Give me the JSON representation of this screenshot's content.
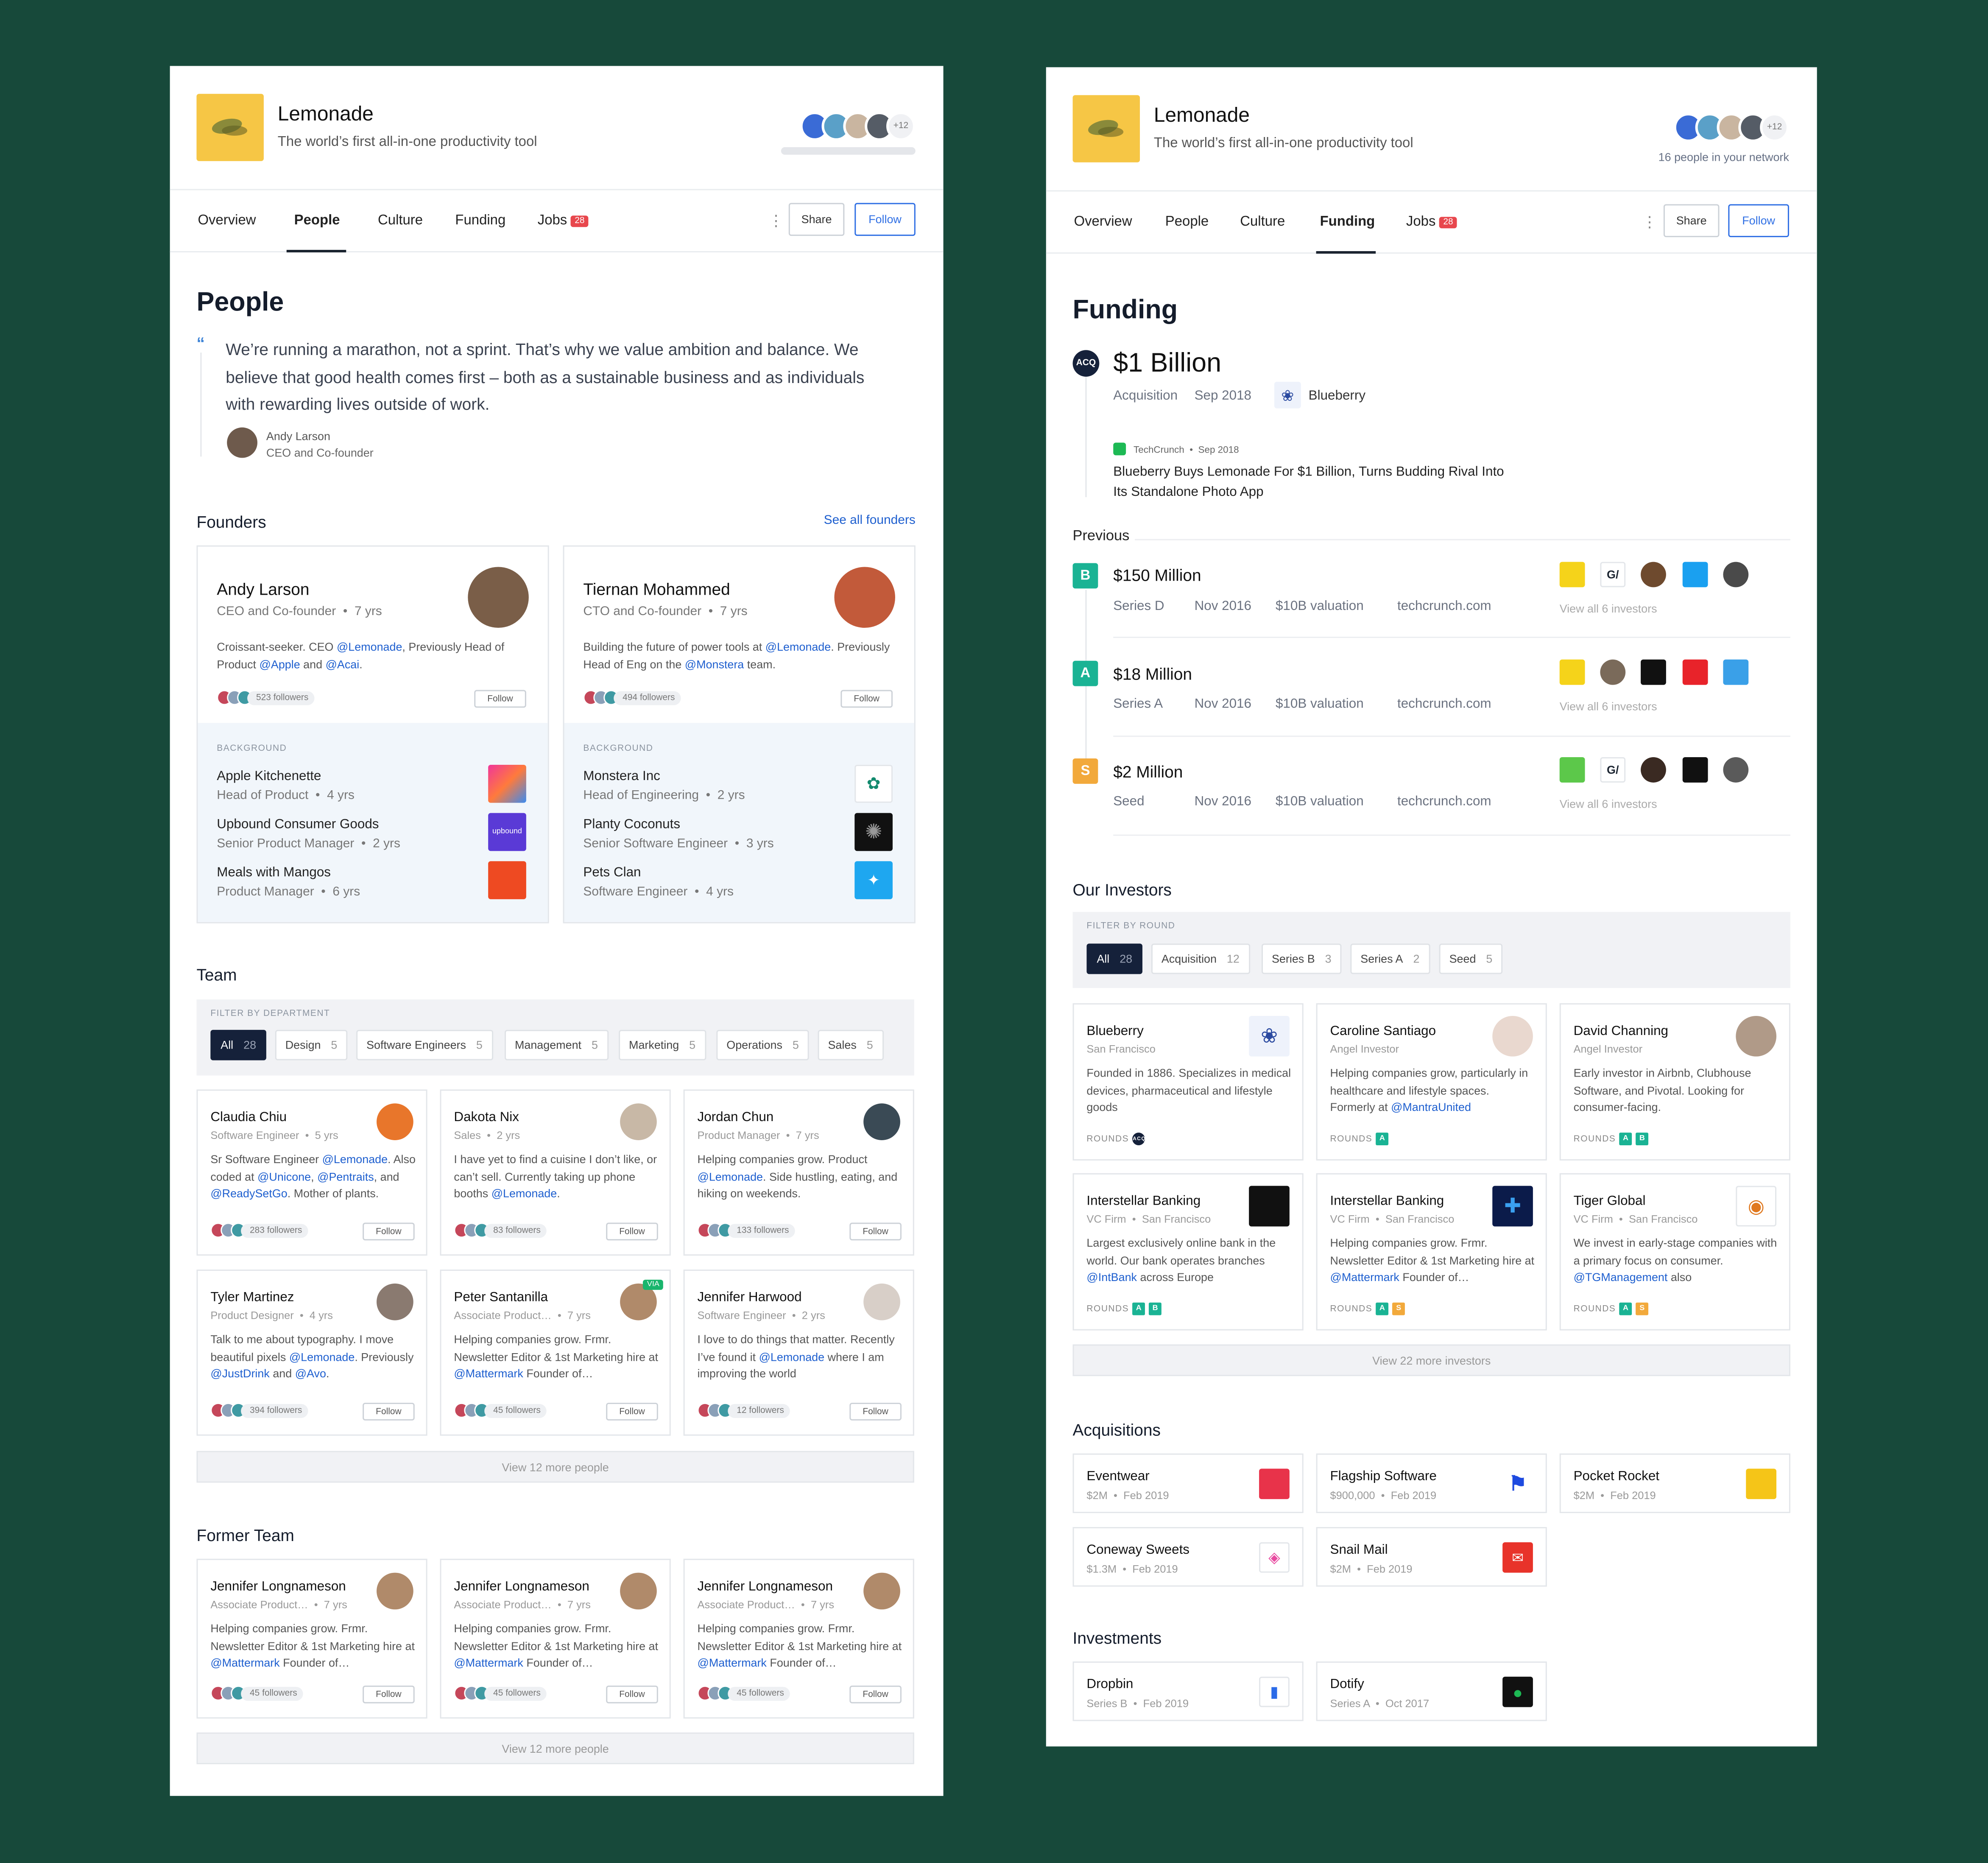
{
  "company": {
    "name": "Lemonade",
    "tagline": "The world’s first all-in-one productivity tool",
    "avatars_more": "+12",
    "network_note": "16 people in your network"
  },
  "nav": {
    "tabs": [
      "Overview",
      "People",
      "Culture",
      "Funding",
      "Jobs"
    ],
    "jobs_count": "28",
    "share": "Share",
    "follow": "Follow",
    "kebab": "⋮"
  },
  "people": {
    "title": "People",
    "quote_mark": "“",
    "quote": "We’re running a marathon, not a sprint. That’s why we value ambition and balance. We believe that good health comes first – both as a sustainable business and as individuals with rewarding lives outside of work.",
    "quote_author": "Andy Larson",
    "quote_role": "CEO and Co-founder",
    "founders_title": "Founders",
    "see_all": "See all founders",
    "founders": [
      {
        "name": "Andy Larson",
        "role": "CEO and Co-founder",
        "years": "7 yrs",
        "desc": [
          "Croissant-seeker. CEO ",
          "@Lemonade",
          ", Previously Head of Product ",
          "@Apple",
          " and ",
          "@Acai",
          "."
        ],
        "followers": "523 followers",
        "follow": "Follow",
        "background_label": "BACKGROUND",
        "background": [
          {
            "company": "Apple Kitchenette",
            "role": "Head of Product",
            "years": "4 yrs",
            "color": "#e84a8a"
          },
          {
            "company": "Upbound Consumer Goods",
            "role": "Senior Product Manager",
            "years": "2 yrs",
            "color": "#5a3ad6",
            "logo_text": "upbound"
          },
          {
            "company": "Meals with Mangos",
            "role": "Product Manager",
            "years": "6 yrs",
            "color": "#ee4a22"
          }
        ]
      },
      {
        "name": "Tiernan Mohammed",
        "role": "CTO and Co-founder",
        "years": "7 yrs",
        "desc": [
          "Building the future of power tools at ",
          "@Lemonade",
          ". Previously Head of Eng on the ",
          "@Monstera",
          " team."
        ],
        "followers": "494 followers",
        "follow": "Follow",
        "background_label": "BACKGROUND",
        "background": [
          {
            "company": "Monstera Inc",
            "role": "Head of Engineering",
            "years": "2 yrs",
            "color": "#ffffff"
          },
          {
            "company": "Planty Coconuts",
            "role": "Senior Software Engineer",
            "years": "3 yrs",
            "color": "#111111"
          },
          {
            "company": "Pets Clan",
            "role": "Software Engineer",
            "years": "4 yrs",
            "color": "#1ea7f0"
          }
        ]
      }
    ],
    "team_title": "Team",
    "filter_label": "FILTER BY DEPARTMENT",
    "filters": [
      {
        "label": "All",
        "count": "28"
      },
      {
        "label": "Design",
        "count": "5"
      },
      {
        "label": "Software Engineers",
        "count": "5"
      },
      {
        "label": "Management",
        "count": "5"
      },
      {
        "label": "Marketing",
        "count": "5"
      },
      {
        "label": "Operations",
        "count": "5"
      },
      {
        "label": "Sales",
        "count": "5"
      }
    ],
    "team": [
      {
        "name": "Claudia Chiu",
        "role": "Software Engineer",
        "years": "5 yrs",
        "desc": [
          "Sr Software Engineer ",
          "@Lemonade",
          ". Also coded at ",
          "@Unicone",
          ", ",
          "@Pentraits",
          ", and ",
          "@ReadySetGo",
          ". Mother of plants."
        ],
        "followers": "283 followers",
        "follow": "Follow",
        "avatar": "#e8762b"
      },
      {
        "name": "Dakota Nix",
        "role": "Sales",
        "years": "2 yrs",
        "desc": [
          "I have yet to find a cuisine I don’t like, or can’t sell. Currently taking up phone booths ",
          "@Lemonade",
          "."
        ],
        "followers": "83 followers",
        "follow": "Follow",
        "avatar": "#c8b8a6"
      },
      {
        "name": "Jordan Chun",
        "role": "Product Manager",
        "years": "7 yrs",
        "desc": [
          "Helping companies grow. Product ",
          "@Lemonade",
          ". Side hustling, eating, and hiking on weekends."
        ],
        "followers": "133 followers",
        "follow": "Follow",
        "avatar": "#3a4a55"
      },
      {
        "name": "Tyler Martinez",
        "role": "Product Designer",
        "years": "4 yrs",
        "desc": [
          "Talk to me about typography. I move beautiful pixels ",
          "@Lemonade",
          ". Previously ",
          "@JustDrink",
          " and ",
          "@Avo",
          "."
        ],
        "followers": "394 followers",
        "follow": "Follow",
        "avatar": "#8a7a70"
      },
      {
        "name": "Peter Santanilla",
        "role": "Associate Product…",
        "years": "7 yrs",
        "desc": [
          "Helping companies grow. Frmr. Newsletter Editor & 1st Marketing hire at ",
          "@Mattermark",
          " Founder of…"
        ],
        "followers": "45 followers",
        "follow": "Follow",
        "avatar": "#b08a6a",
        "via": "VIA"
      },
      {
        "name": "Jennifer Harwood",
        "role": "Software Engineer",
        "years": "2 yrs",
        "desc": [
          "I love to do things that matter. Recently I’ve found it ",
          "@Lemonade",
          " where I am improving the world"
        ],
        "followers": "12 followers",
        "follow": "Follow",
        "avatar": "#d8cfc8"
      }
    ],
    "view_more": "View 12 more people",
    "former_title": "Former Team",
    "former": [
      {
        "name": "Jennifer Longnameson",
        "role": "Associate Product…",
        "years": "7 yrs",
        "desc": [
          "Helping companies grow. Frmr. Newsletter Editor & 1st Marketing hire at ",
          "@Mattermark",
          " Founder of…"
        ],
        "followers": "45 followers",
        "follow": "Follow",
        "avatar": "#b08a6a"
      },
      {
        "name": "Jennifer Longnameson",
        "role": "Associate Product…",
        "years": "7 yrs",
        "desc": [
          "Helping companies grow. Frmr. Newsletter Editor & 1st Marketing hire at ",
          "@Mattermark",
          " Founder of…"
        ],
        "followers": "45 followers",
        "follow": "Follow",
        "avatar": "#b08a6a"
      },
      {
        "name": "Jennifer Longnameson",
        "role": "Associate Product…",
        "years": "7 yrs",
        "desc": [
          "Helping companies grow. Frmr. Newsletter Editor & 1st Marketing hire at ",
          "@Mattermark",
          " Founder of…"
        ],
        "followers": "45 followers",
        "follow": "Follow",
        "avatar": "#b08a6a"
      }
    ],
    "former_view_more": "View 12 more people"
  },
  "funding": {
    "title": "Funding",
    "acq_badge": "ACQ",
    "acq_amount": "$1 Billion",
    "acq_type": "Acquisition",
    "acq_date": "Sep 2018",
    "acq_by": "Blueberry",
    "news_source": "TechCrunch",
    "news_date": "Sep 2018",
    "news_title": "Blueberry Buys Lemonade For $1 Billion, Turns Budding Rival Into Its Standalone Photo App",
    "previous_title": "Previous",
    "rounds": [
      {
        "letter": "B",
        "color": "#1ab394",
        "amount": "$150 Million",
        "series": "Series D",
        "date": "Nov 2016",
        "valuation": "$10B valuation",
        "source": "techcrunch.com",
        "view": "View all 6 investors"
      },
      {
        "letter": "A",
        "color": "#1ab394",
        "amount": "$18 Million",
        "series": "Series A",
        "date": "Nov 2016",
        "valuation": "$10B valuation",
        "source": "techcrunch.com",
        "view": "View all 6 investors"
      },
      {
        "letter": "S",
        "color": "#f2a93b",
        "amount": "$2 Million",
        "series": "Seed",
        "date": "Nov 2016",
        "valuation": "$10B valuation",
        "source": "techcrunch.com",
        "view": "View all 6 investors"
      }
    ],
    "investors_title": "Our Investors",
    "filter_label": "FILTER BY ROUND",
    "filters": [
      {
        "label": "All",
        "count": "28"
      },
      {
        "label": "Acquisition",
        "count": "12"
      },
      {
        "label": "Series B",
        "count": "3"
      },
      {
        "label": "Series A",
        "count": "2"
      },
      {
        "label": "Seed",
        "count": "5"
      }
    ],
    "rounds_label": "ROUNDS",
    "investors": [
      {
        "name": "Blueberry",
        "type": "",
        "location": "San Francisco",
        "desc": [
          "Founded in 1886. Specializes in medical devices, pharmaceutical and lifestyle goods"
        ],
        "rounds": [
          "ACQ"
        ]
      },
      {
        "name": "Caroline Santiago",
        "type": "",
        "location": "Angel Investor",
        "desc": [
          "Helping companies grow, particularly in healthcare and lifestyle spaces. Formerly at ",
          "@MantraUnited"
        ],
        "rounds": [
          "A"
        ]
      },
      {
        "name": "David Channing",
        "type": "",
        "location": "Angel Investor",
        "desc": [
          "Early investor in Airbnb, Clubhouse Software, and Pivotal. Looking for consumer-facing."
        ],
        "rounds": [
          "A",
          "B"
        ]
      },
      {
        "name": "Interstellar Banking",
        "type": "VC Firm",
        "location": "San Francisco",
        "desc": [
          "Largest exclusively online bank in the world. Our bank operates branches ",
          "@IntBank",
          " across Europe"
        ],
        "rounds": [
          "A",
          "B"
        ]
      },
      {
        "name": "Interstellar Banking",
        "type": "VC Firm",
        "location": "San Francisco",
        "desc": [
          "Helping companies grow. Frmr. Newsletter Editor & 1st Marketing hire at ",
          "@Mattermark",
          " Founder of…"
        ],
        "rounds": [
          "A",
          "S"
        ]
      },
      {
        "name": "Tiger Global",
        "type": "VC Firm",
        "location": "San Francisco",
        "desc": [
          "We invest in early-stage companies with a primary focus on consumer. ",
          "@TGManagement",
          " also"
        ],
        "rounds": [
          "A",
          "S"
        ]
      }
    ],
    "view_more_investors": "View 22 more investors",
    "acquisitions_title": "Acquisitions",
    "acquisitions": [
      {
        "name": "Eventwear",
        "amount": "$2M",
        "date": "Feb 2019",
        "color": "#e8334a"
      },
      {
        "name": "Flagship Software",
        "amount": "$900,000",
        "date": "Feb 2019",
        "color": "#ffffff"
      },
      {
        "name": "Pocket Rocket",
        "amount": "$2M",
        "date": "Feb 2019",
        "color": "#f5c518"
      },
      {
        "name": "Coneway Sweets",
        "amount": "$1.3M",
        "date": "Feb 2019",
        "color": "#ffffff"
      },
      {
        "name": "Snail Mail",
        "amount": "$2M",
        "date": "Feb 2019",
        "color": "#e8332a"
      }
    ],
    "investments_title": "Investments",
    "investments": [
      {
        "name": "Dropbin",
        "series": "Series B",
        "date": "Feb 2019",
        "color": "#ffffff"
      },
      {
        "name": "Dotify",
        "series": "Series A",
        "date": "Oct 2017",
        "color": "#111111"
      }
    ]
  }
}
